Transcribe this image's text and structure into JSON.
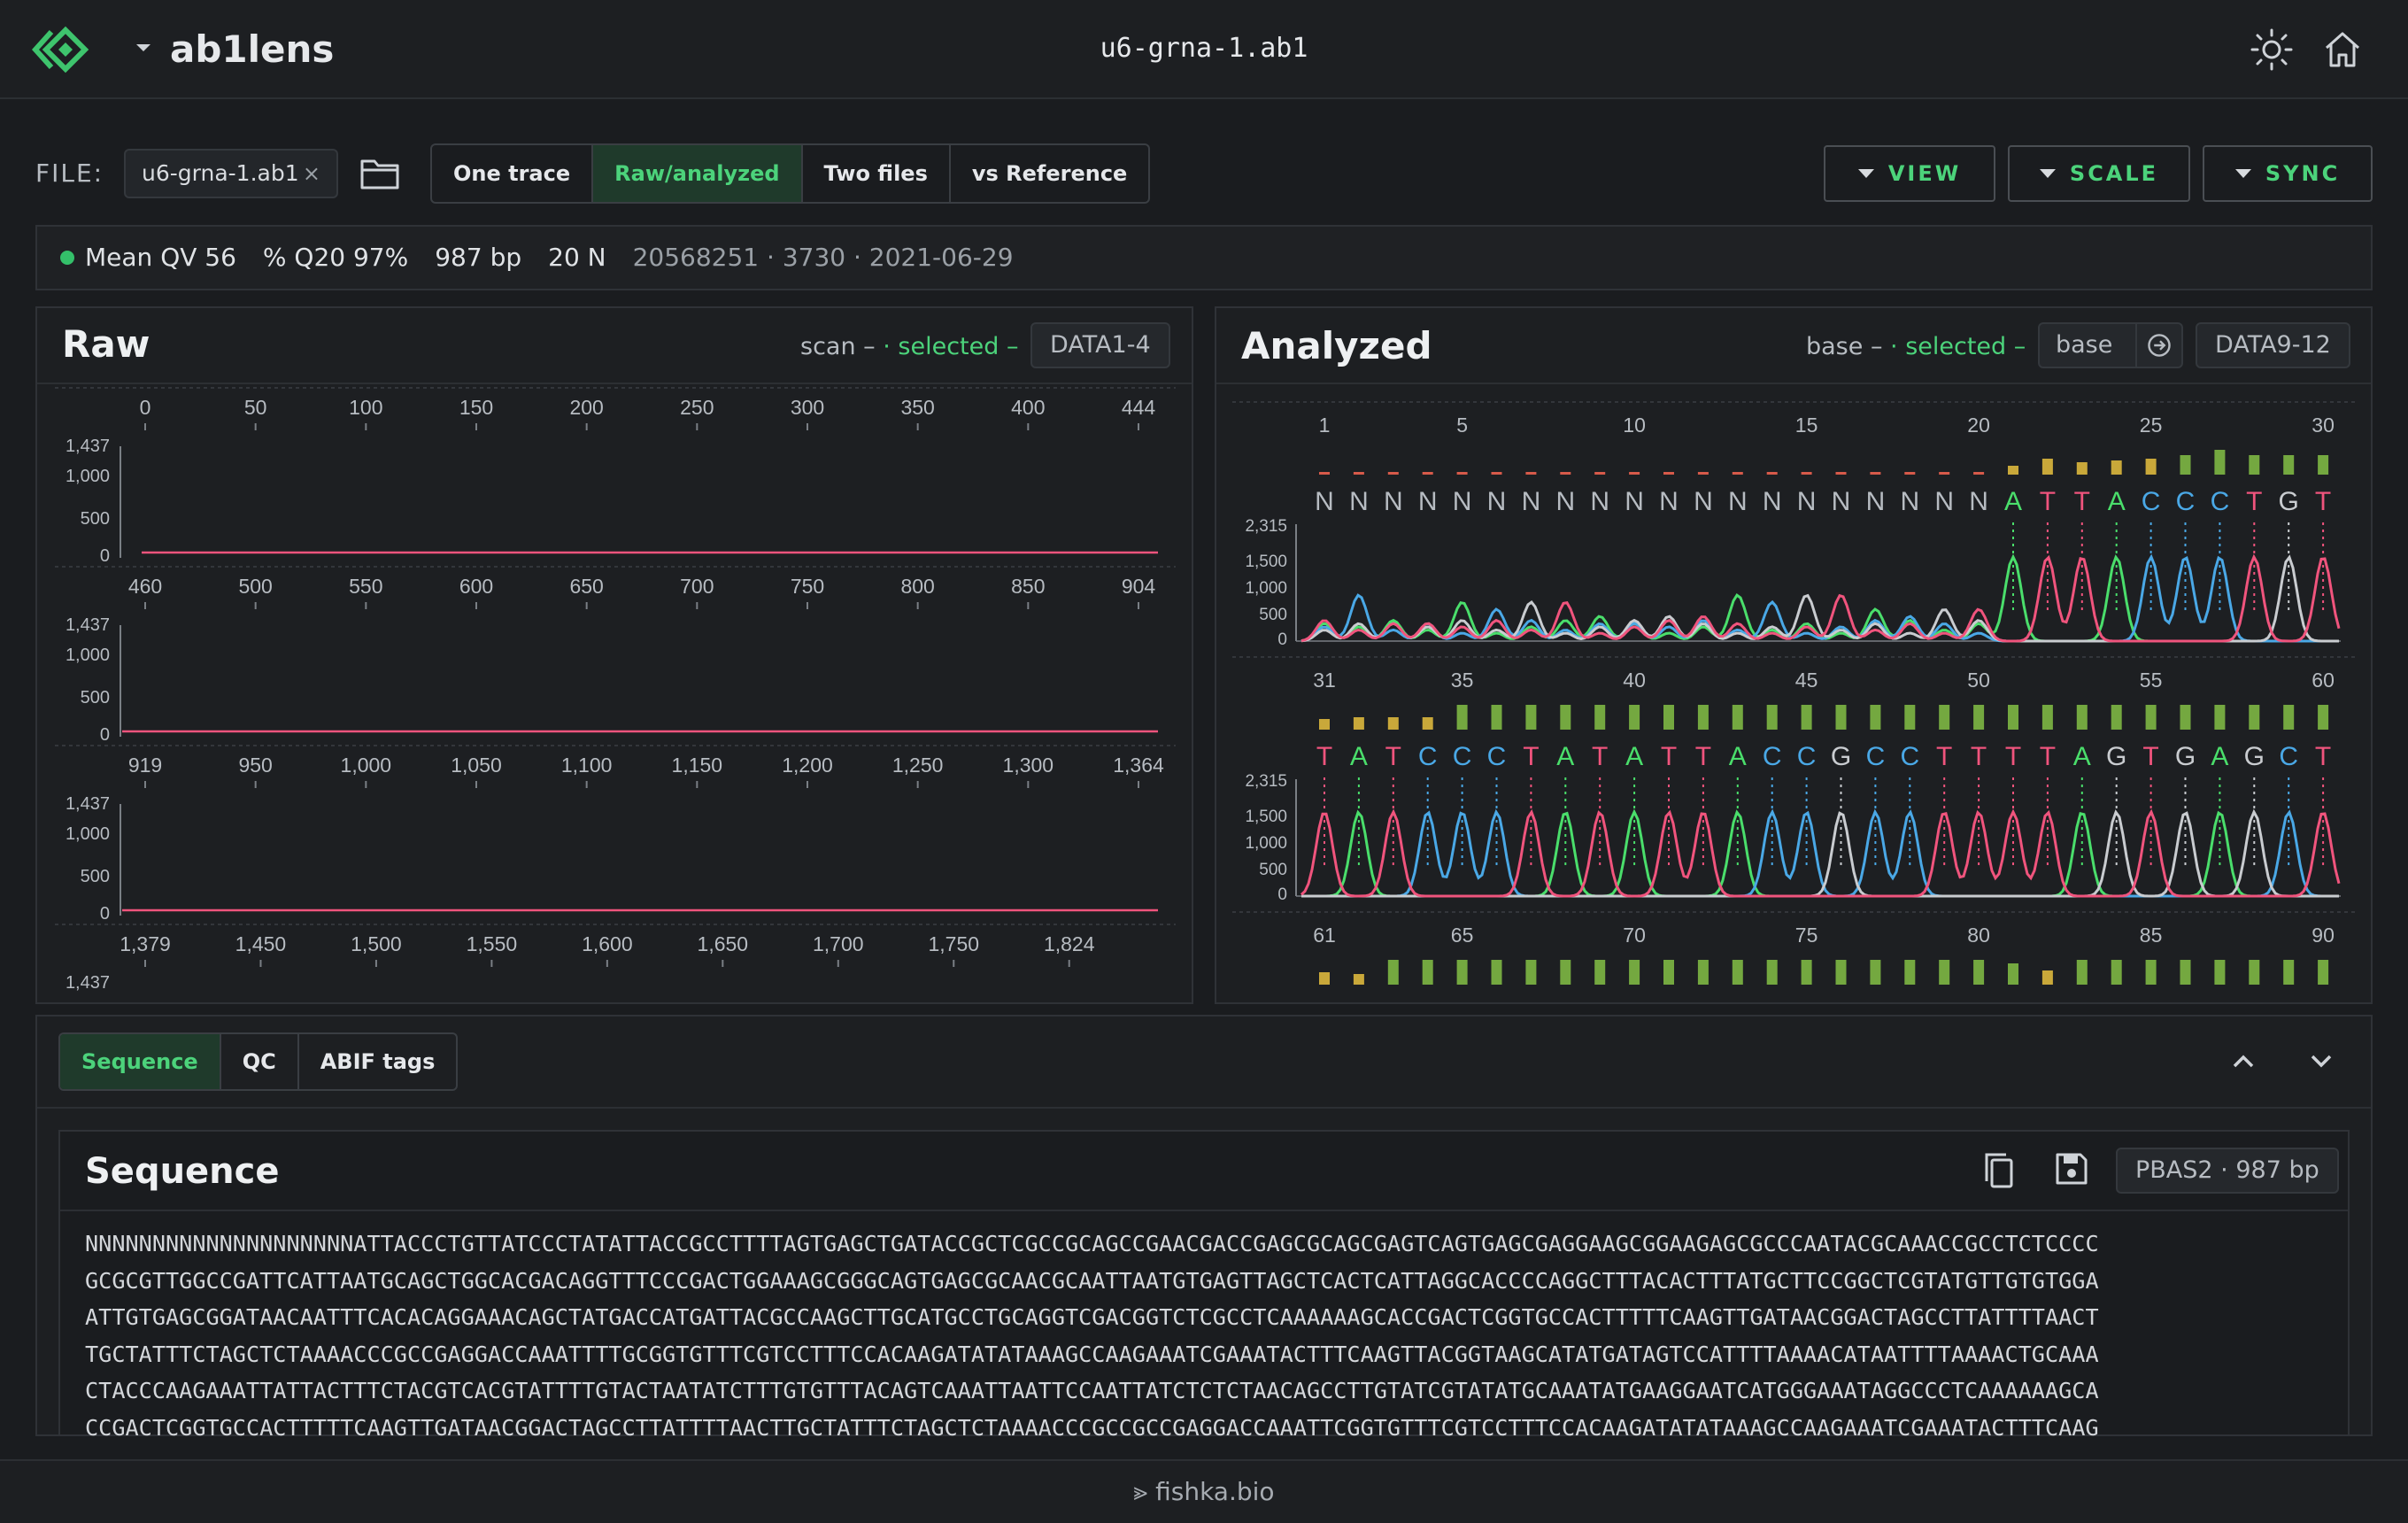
{
  "app": {
    "title": "ab1lens",
    "file_title": "u6-grna-1.ab1"
  },
  "file": {
    "label": "FILE:",
    "name": "u6-grna-1.ab1",
    "close_glyph": "×"
  },
  "modes": [
    "One trace",
    "Raw/analyzed",
    "Two files",
    "vs Reference"
  ],
  "active_mode": "Raw/analyzed",
  "header_buttons": {
    "view": "VIEW",
    "scale": "SCALE",
    "sync": "SYNC"
  },
  "stats": {
    "mean_qv": "Mean QV 56",
    "q20": "% Q20 97%",
    "length": "987 bp",
    "n_count": "20 N",
    "meta": "20568251 · 3730 · 2021-06-29"
  },
  "raw": {
    "title": "Raw",
    "meta_prefix": "scan –",
    "meta_selected": "· selected –",
    "tag": "DATA1-4",
    "rows": [
      {
        "ticks": [
          "0",
          "50",
          "100",
          "150",
          "200",
          "250",
          "300",
          "350",
          "400",
          "444"
        ],
        "y_ticks": [
          "1,437",
          "1,000",
          "500",
          "0"
        ]
      },
      {
        "ticks": [
          "460",
          "500",
          "550",
          "600",
          "650",
          "700",
          "750",
          "800",
          "850",
          "904"
        ],
        "y_ticks": [
          "1,437",
          "1,000",
          "500",
          "0"
        ]
      },
      {
        "ticks": [
          "919",
          "950",
          "1,000",
          "1,050",
          "1,100",
          "1,150",
          "1,200",
          "1,250",
          "1,300",
          "1,364"
        ],
        "y_ticks": [
          "1,437",
          "1,000",
          "500",
          "0"
        ]
      },
      {
        "ticks": [
          "1,379",
          "1,450",
          "1,500",
          "1,550",
          "1,600",
          "1,650",
          "1,700",
          "1,750",
          "1,824"
        ],
        "y_ticks": [
          "1,437"
        ]
      }
    ]
  },
  "analyzed": {
    "title": "Analyzed",
    "meta_prefix": "base –",
    "meta_selected": "· selected –",
    "mode_label": "base",
    "tag": "DATA9-12",
    "rows": [
      {
        "ticks": [
          "1",
          "5",
          "10",
          "15",
          "20",
          "25",
          "30"
        ],
        "bases": "NNNNNNNNNNNNNNNNNNNNATTACCCTGT",
        "y_ticks": [
          "2,315",
          "1,500",
          "1,000",
          "500",
          "0"
        ]
      },
      {
        "ticks": [
          "31",
          "35",
          "40",
          "45",
          "50",
          "55",
          "60"
        ],
        "bases": "TATCCCTATATTACCGCCTTTTAGTGAGCT",
        "y_ticks": [
          "2,315",
          "1,500",
          "1,000",
          "500",
          "0"
        ]
      },
      {
        "ticks": [
          "61",
          "65",
          "70",
          "75",
          "80",
          "85",
          "90"
        ],
        "bases": "",
        "y_ticks": []
      }
    ],
    "quality": [
      2,
      2,
      2,
      2,
      2,
      2,
      2,
      2,
      2,
      2,
      2,
      2,
      2,
      2,
      2,
      2,
      2,
      2,
      2,
      2,
      10,
      18,
      14,
      16,
      18,
      22,
      28,
      22,
      22,
      22,
      12,
      14,
      14,
      14,
      28,
      28,
      28,
      28,
      28,
      28,
      28,
      28,
      28,
      28,
      28,
      28,
      28,
      28,
      28,
      28,
      28,
      28,
      28,
      28,
      28,
      28,
      28,
      28,
      28,
      28,
      14,
      12,
      28,
      28,
      28,
      28,
      28,
      28,
      28,
      28,
      28,
      28,
      28,
      28,
      28,
      28,
      28,
      28,
      28,
      28,
      24,
      16,
      28,
      28,
      28,
      28,
      28,
      28,
      28,
      28
    ]
  },
  "colors": {
    "A": "#4ade6b",
    "C": "#4aa8e6",
    "G": "#c9ccd0",
    "T": "#f0547d",
    "N": "#b7bcc2",
    "accent": "#4cd37b",
    "quality": "#74a840"
  },
  "tabs": [
    "Sequence",
    "QC",
    "ABIF tags"
  ],
  "active_tab": "Sequence",
  "sequence": {
    "title": "Sequence",
    "tag": "PBAS2 · 987 bp",
    "lines": [
      "NNNNNNNNNNNNNNNNNNNNATTACCCTGTTATCCCTATATTACCGCCTTTTAGTGAGCTGATACCGCTCGCCGCAGCCGAACGACCGAGCGCAGCGAGTCAGTGAGCGAGGAAGCGGAAGAGCGCCCAATACGCAAACCGCCTCTCCCC",
      "GCGCGTTGGCCGATTCATTAATGCAGCTGGCACGACAGGTTTCCCGACTGGAAAGCGGGCAGTGAGCGCAACGCAATTAATGTGAGTTAGCTCACTCATTAGGCACCCCAGGCTTTACACTTTATGCTTCCGGCTCGTATGTTGTGTGGA",
      "ATTGTGAGCGGATAACAATTTCACACAGGAAACAGCTATGACCATGATTACGCCAAGCTTGCATGCCTGCAGGTCGACGGTCTCGCCTCAAAAAAGCACCGACTCGGTGCCACTTTTTCAAGTTGATAACGGACTAGCCTTATTTTAACT",
      "TGCTATTTCTAGCTCTAAAACCCGCCGAGGACCAAATTTTGCGGTGTTTCGTCCTTTCCACAAGATATATAAAGCCAAGAAATCGAAATACTTTCAAGTTACGGTAAGCATATGATAGTCCATTTTAAAACATAATTTTAAAACTGCAAA",
      "CTACCCAAGAAATTATTACTTTCTACGTCACGTATTTTGTACTAATATCTTTGTGTTTACAGTCAAATTAATTCCAATTATCTCTCTAACAGCCTTGTATCGTATATGCAAATATGAAGGAATCATGGGAAATAGGCCCTCAAAAAAGCA",
      "CCGACTCGGTGCCACTTTTTCAAGTTGATAACGGACTAGCCTTATTTTAACTTGCTATTTCTAGCTCTAAAACCCGCCGCCGAGGACCAAATTCGGTGTTTCGTCCTTTCCACAAGATATATAAAGCCAAGAAATCGAAATACTTTCAAG"
    ]
  },
  "footer": "⪢ fishka.bio"
}
